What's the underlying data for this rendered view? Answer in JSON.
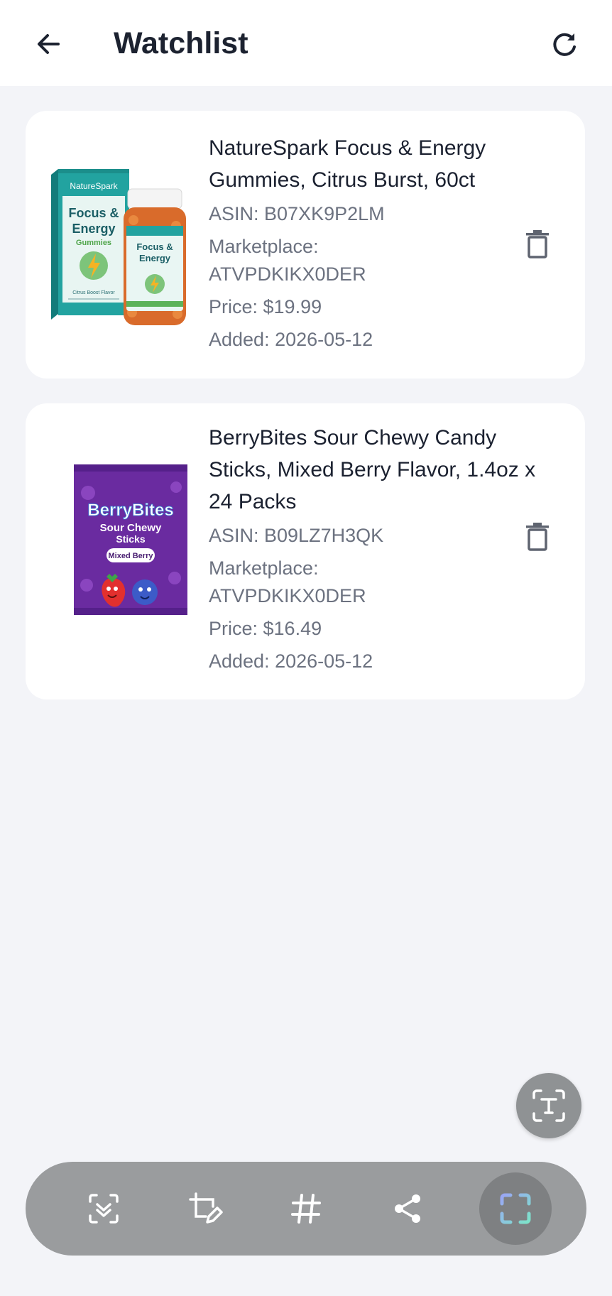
{
  "header": {
    "title": "Watchlist",
    "back_icon": "arrow-left-icon",
    "refresh_icon": "refresh-icon"
  },
  "items": [
    {
      "name": "NatureSpark Focus & Energy Gummies, Citrus Burst, 60ct",
      "asin": "ASIN: B07XK9P2LM",
      "marketplace_label": "Marketplace:",
      "marketplace": "ATVPDKIKX0DER",
      "price": "Price: $19.99",
      "added": "Added: 2026-05-12",
      "image": {
        "brand": "NatureSpark",
        "line1": "Focus &",
        "line2": "Energy",
        "line3": "Gummies",
        "flavor": "Citrus Boost Flavor"
      }
    },
    {
      "name": "BerryBites Sour Chewy Candy Sticks, Mixed Berry Flavor, 1.4oz x 24 Packs",
      "asin": "ASIN: B09LZ7H3QK",
      "marketplace_label": "Marketplace:",
      "marketplace": "ATVPDKIKX0DER",
      "price": "Price: $16.49",
      "added": "Added: 2026-05-12",
      "image": {
        "brand": "BerryBites",
        "line1": "Sour Chewy",
        "line2": "Sticks",
        "flavor": "Mixed Berry"
      }
    }
  ],
  "overlay": {
    "text_button_icon": "text-recognition-icon",
    "toolbar_icons": [
      "scan-icon",
      "crop-edit-icon",
      "hashtag-icon",
      "share-icon",
      "screenshot-frame-icon"
    ]
  },
  "colors": {
    "background": "#F3F4F8",
    "card": "#FFFFFF",
    "title": "#1C2230",
    "meta": "#6C7280",
    "toolbar": "#9A9C9E",
    "teal": "#1E9A98",
    "purple": "#6A2BA0"
  }
}
